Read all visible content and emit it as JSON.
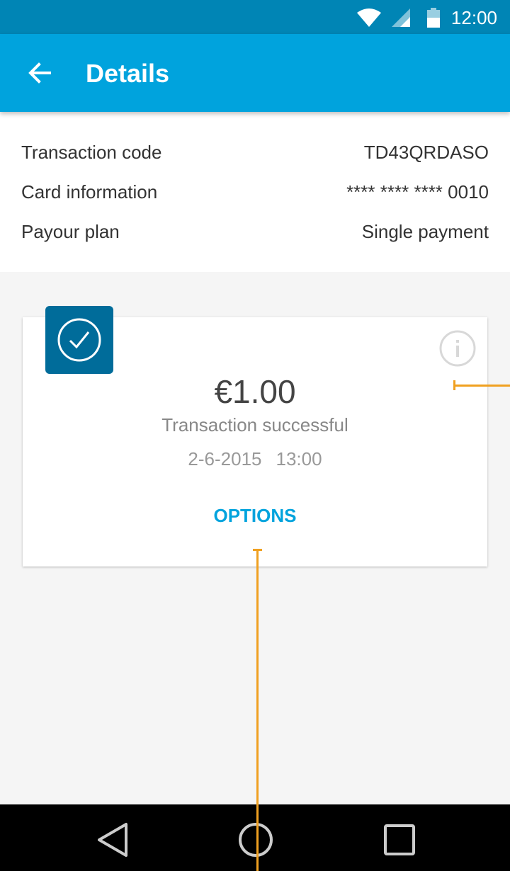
{
  "status_bar": {
    "time": "12:00",
    "icons": [
      "wifi-icon",
      "signal-icon",
      "battery-icon"
    ]
  },
  "app_bar": {
    "title": "Details",
    "back_icon": "arrow-left-icon"
  },
  "details": {
    "rows": [
      {
        "label": "Transaction code",
        "value": "TD43QRDASO"
      },
      {
        "label": "Card information",
        "value": "**** **** **** 0010"
      },
      {
        "label": "Payour plan",
        "value": "Single payment"
      }
    ]
  },
  "transaction_card": {
    "status_icon": "check-circle-icon",
    "info_icon": "info-icon",
    "amount": "€1.00",
    "status": "Transaction successful",
    "date": "2-6-2015",
    "time": "13:00",
    "options_label": "OPTIONS"
  },
  "navigation": {
    "icons": [
      "triangle-back-icon",
      "circle-home-icon",
      "square-recents-icon"
    ]
  },
  "colors": {
    "status_bar": "#0085b5",
    "app_bar": "#00a3dd",
    "badge": "#006c9a",
    "accent": "#00a3dd",
    "callout": "#f0a020"
  }
}
